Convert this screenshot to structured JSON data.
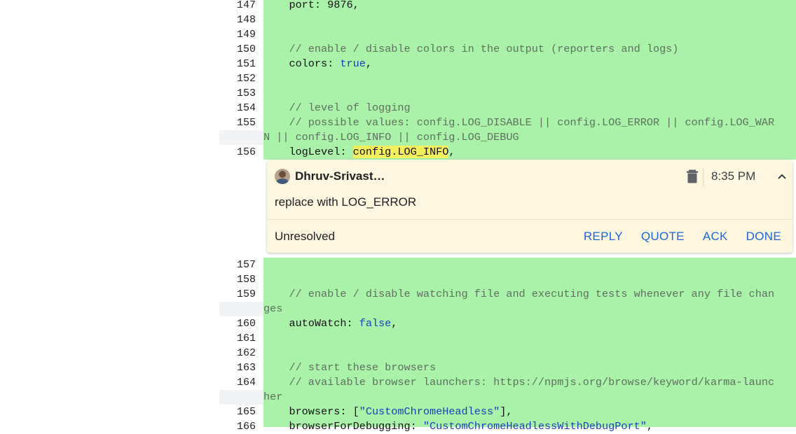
{
  "code_lines_top": [
    {
      "num": "147",
      "segments": [
        {
          "t": "    port: 9876,",
          "c": ""
        }
      ]
    },
    {
      "num": "148",
      "segments": []
    },
    {
      "num": "149",
      "segments": []
    },
    {
      "num": "150",
      "segments": [
        {
          "t": "    // enable / disable colors in the output (reporters and logs)",
          "c": "cmt"
        }
      ]
    },
    {
      "num": "151",
      "segments": [
        {
          "t": "    colors: ",
          "c": ""
        },
        {
          "t": "true",
          "c": "kw"
        },
        {
          "t": ",",
          "c": ""
        }
      ]
    },
    {
      "num": "152",
      "segments": []
    },
    {
      "num": "153",
      "segments": []
    },
    {
      "num": "154",
      "segments": [
        {
          "t": "    // level of logging",
          "c": "cmt"
        }
      ]
    },
    {
      "num": "155",
      "segments": [
        {
          "t": "    // possible values: config.LOG_DISABLE || config.LOG_ERROR || config.LOG_WAR",
          "c": "cmt"
        }
      ]
    },
    {
      "num": "",
      "wrap": true,
      "segments": [
        {
          "t": "N || config.LOG_INFO || config.LOG_DEBUG",
          "c": "cmt"
        }
      ]
    },
    {
      "num": "156",
      "segments": [
        {
          "t": "    logLevel: ",
          "c": ""
        },
        {
          "t": "config.LOG_INFO",
          "c": "hl"
        },
        {
          "t": ",",
          "c": ""
        }
      ]
    }
  ],
  "code_lines_bottom": [
    {
      "num": "157",
      "segments": []
    },
    {
      "num": "158",
      "segments": []
    },
    {
      "num": "159",
      "segments": [
        {
          "t": "    // enable / disable watching file and executing tests whenever any file chan",
          "c": "cmt"
        }
      ]
    },
    {
      "num": "",
      "wrap": true,
      "segments": [
        {
          "t": "ges",
          "c": "cmt"
        }
      ]
    },
    {
      "num": "160",
      "segments": [
        {
          "t": "    autoWatch: ",
          "c": ""
        },
        {
          "t": "false",
          "c": "kw"
        },
        {
          "t": ",",
          "c": ""
        }
      ]
    },
    {
      "num": "161",
      "segments": []
    },
    {
      "num": "162",
      "segments": []
    },
    {
      "num": "163",
      "segments": [
        {
          "t": "    // start these browsers",
          "c": "cmt"
        }
      ]
    },
    {
      "num": "164",
      "segments": [
        {
          "t": "    // available browser launchers: https://npmjs.org/browse/keyword/karma-launc",
          "c": "cmt"
        }
      ]
    },
    {
      "num": "",
      "wrap": true,
      "segments": [
        {
          "t": "her",
          "c": "cmt"
        }
      ]
    },
    {
      "num": "165",
      "segments": [
        {
          "t": "    browsers: [",
          "c": ""
        },
        {
          "t": "\"CustomChromeHeadless\"",
          "c": "str"
        },
        {
          "t": "],",
          "c": ""
        }
      ]
    },
    {
      "num": "166",
      "segments": [
        {
          "t": "    browserForDebugging: ",
          "c": ""
        },
        {
          "t": "\"CustomChromeHeadlessWithDebugPort\"",
          "c": "str"
        },
        {
          "t": ",",
          "c": ""
        }
      ]
    }
  ],
  "comment": {
    "author": "Dhruv-Srivast…",
    "time": "8:35 PM",
    "body": "replace with LOG_ERROR",
    "status": "Unresolved",
    "actions": {
      "reply": "REPLY",
      "quote": "QUOTE",
      "ack": "ACK",
      "done": "DONE"
    }
  },
  "icons": {
    "delete": "trash-icon",
    "collapse": "chevron-up-icon",
    "avatar": "avatar"
  },
  "colors": {
    "added_bg": "#aaf2aa",
    "comment_bg": "#fef7e0",
    "link": "#1a66d9"
  }
}
